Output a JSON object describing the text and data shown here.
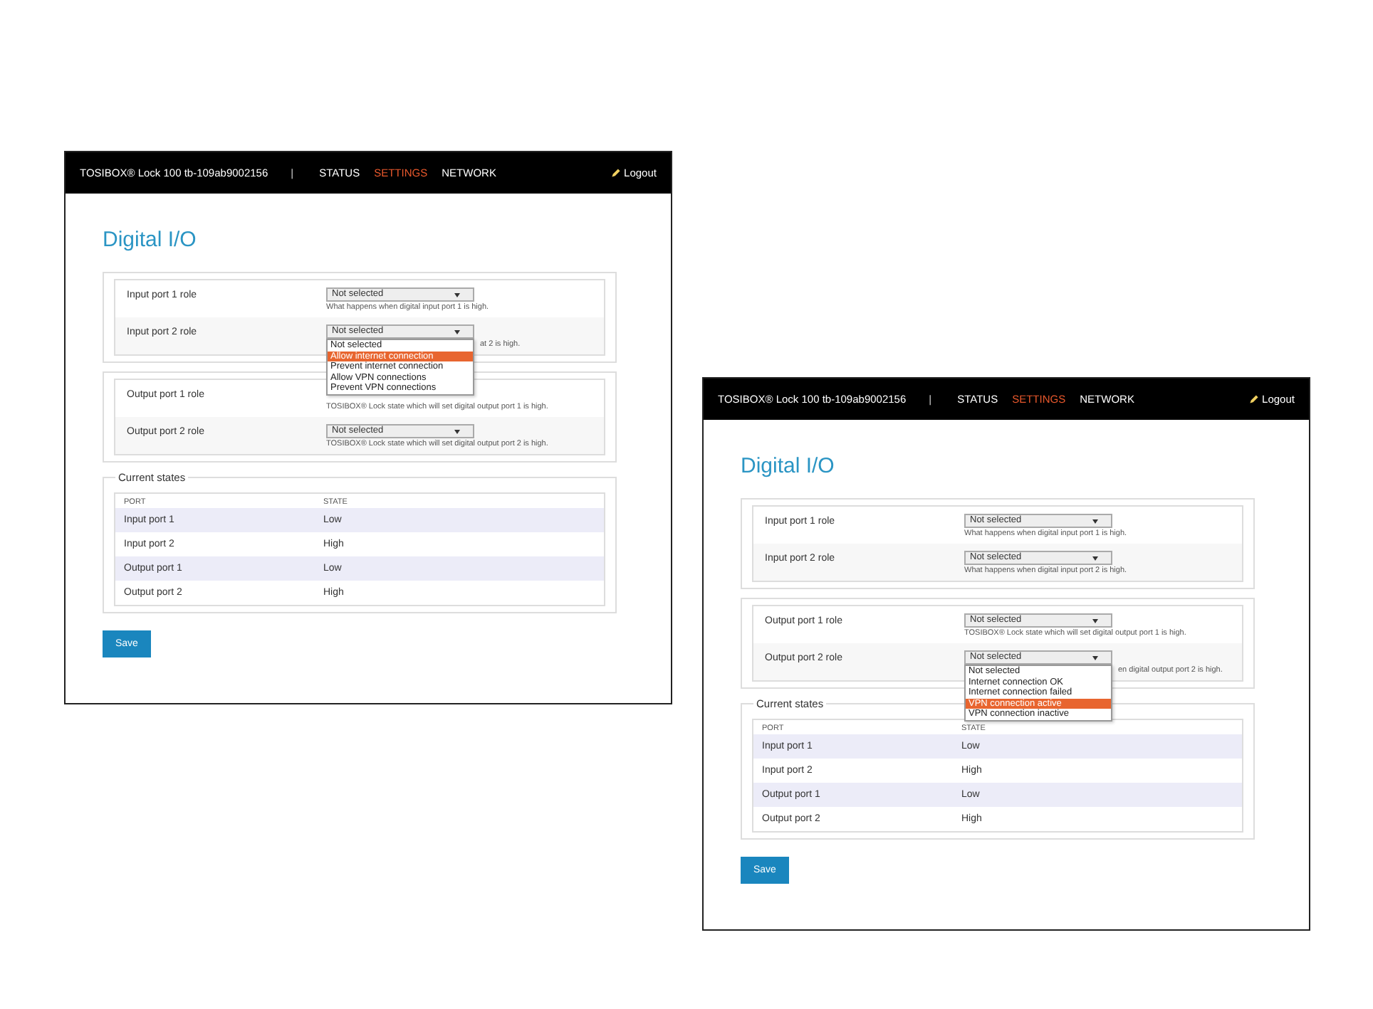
{
  "screenshots": [
    {
      "header": {
        "brand": "TOSIBOX® Lock 100 tb-109ab9002156",
        "separator": "|",
        "nav": [
          {
            "label": "STATUS",
            "selected": false
          },
          {
            "label": "SETTINGS",
            "selected": true
          },
          {
            "label": "NETWORK",
            "selected": false
          }
        ],
        "logout": "Logout"
      },
      "title": "Digital I/O",
      "groups": [
        {
          "rows": [
            {
              "label": "Input port 1 role",
              "select": "Not selected",
              "help": "What happens when digital input port 1 is high.",
              "help_covered": false
            },
            {
              "label": "Input port 2 role",
              "select": "Not selected",
              "help": "at 2 is high.",
              "help_covered": true,
              "dropdown": [
                {
                  "label": "Not selected",
                  "selected": false
                },
                {
                  "label": "Allow internet connection",
                  "selected": true
                },
                {
                  "label": "Prevent internet connection",
                  "selected": false
                },
                {
                  "label": "Allow VPN connections",
                  "selected": false
                },
                {
                  "label": "Prevent VPN connections",
                  "selected": false
                }
              ]
            }
          ]
        },
        {
          "rows": [
            {
              "label": "Output port 1 role",
              "help": "TOSIBOX® Lock state which will set digital output port 1 is high.",
              "help_covered": false
            },
            {
              "label": "Output port 2 role",
              "select": "Not selected",
              "help": "TOSIBOX® Lock state which will set digital output port 2 is high.",
              "help_covered": false
            }
          ]
        }
      ],
      "states": {
        "legend": "Current states",
        "columns": [
          "PORT",
          "STATE"
        ],
        "rows": [
          [
            "Input port 1",
            "Low"
          ],
          [
            "Input port 2",
            "High"
          ],
          [
            "Output port 1",
            "Low"
          ],
          [
            "Output port 2",
            "High"
          ]
        ]
      },
      "save": "Save"
    },
    {
      "header": {
        "brand": "TOSIBOX® Lock 100 tb-109ab9002156",
        "separator": "|",
        "nav": [
          {
            "label": "STATUS",
            "selected": false
          },
          {
            "label": "SETTINGS",
            "selected": true
          },
          {
            "label": "NETWORK",
            "selected": false
          }
        ],
        "logout": "Logout"
      },
      "title": "Digital I/O",
      "groups": [
        {
          "rows": [
            {
              "label": "Input port 1 role",
              "select": "Not selected",
              "help": "What happens when digital input port 1 is high.",
              "help_covered": false
            },
            {
              "label": "Input port 2 role",
              "select": "Not selected",
              "help": "What happens when digital input port 2 is high.",
              "help_covered": false
            }
          ]
        },
        {
          "rows": [
            {
              "label": "Output port 1 role",
              "select": "Not selected",
              "help": "TOSIBOX® Lock state which will set digital output port 1 is high.",
              "help_covered": false
            },
            {
              "label": "Output port 2 role",
              "select": "Not selected",
              "help": "en digital output port 2 is high.",
              "help_covered": true,
              "dropdown": [
                {
                  "label": "Not selected",
                  "selected": false
                },
                {
                  "label": "Internet connection OK",
                  "selected": false
                },
                {
                  "label": "Internet connection failed",
                  "selected": false
                },
                {
                  "label": "VPN connection active",
                  "selected": true
                },
                {
                  "label": "VPN connection inactive",
                  "selected": false
                }
              ]
            }
          ]
        }
      ],
      "states": {
        "legend": "Current states",
        "columns": [
          "PORT",
          "STATE"
        ],
        "rows": [
          [
            "Input port 1",
            "Low"
          ],
          [
            "Input port 2",
            "High"
          ],
          [
            "Output port 1",
            "Low"
          ],
          [
            "Output port 2",
            "High"
          ]
        ]
      },
      "save": "Save"
    }
  ]
}
